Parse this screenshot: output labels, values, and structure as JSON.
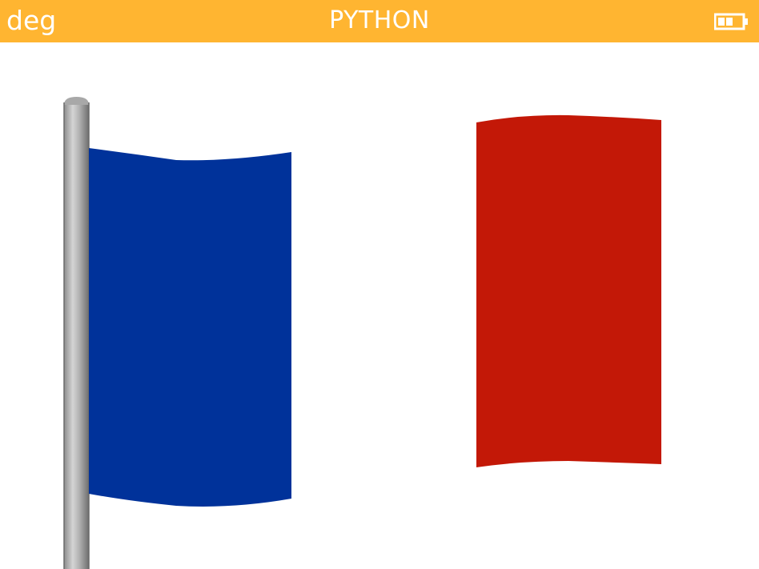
{
  "status_bar": {
    "angle_mode": "deg",
    "app_title": "PYTHON",
    "background_color": "#FFB531",
    "text_color": "#ffffff",
    "battery_icon": "battery-icon"
  },
  "drawing": {
    "description_icon": "flag-icon",
    "colors": {
      "blue": "#00329A",
      "red": "#C31807",
      "pole_light": "#C8C8C8",
      "pole_dark": "#7A7A7A",
      "background": "#ffffff"
    }
  }
}
